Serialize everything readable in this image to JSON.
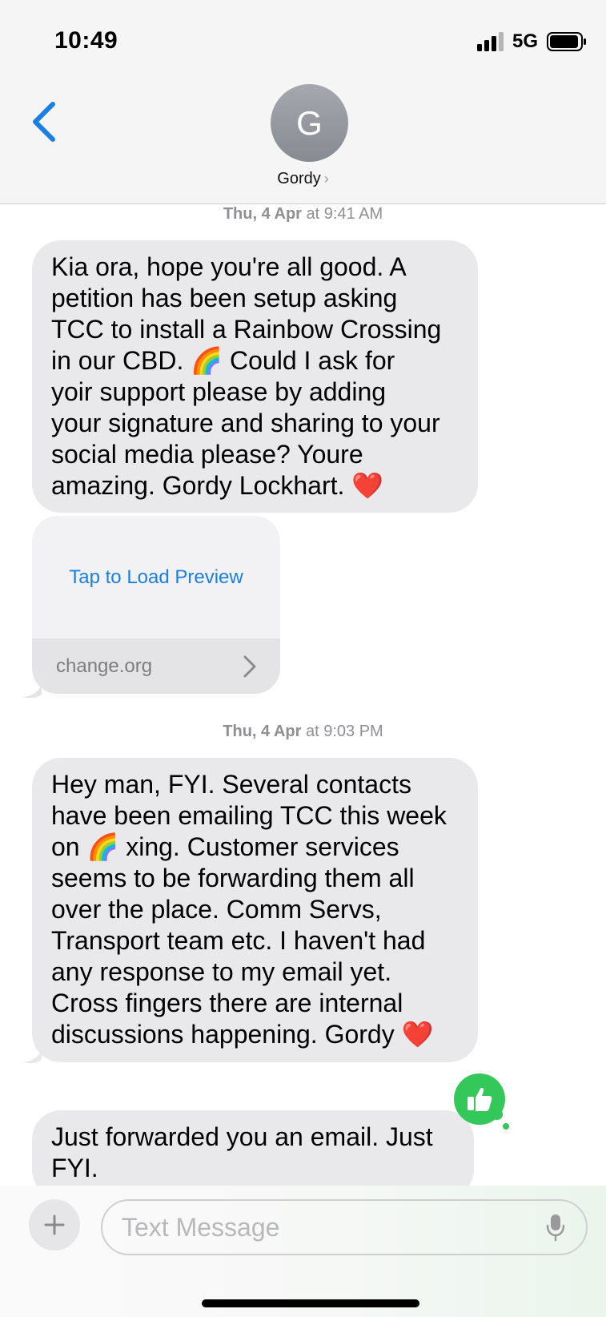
{
  "status_bar": {
    "time": "10:49",
    "network": "5G"
  },
  "header": {
    "avatar_initial": "G",
    "contact_name": "Gordy",
    "chevron": "›"
  },
  "conversation": {
    "timestamp_1": {
      "date": "Thu, 4 Apr",
      "connector": "at",
      "time": "9:41 AM"
    },
    "message_1": {
      "lines": [
        "Kia ora, hope you're all good. A",
        "petition has been setup asking",
        "TCC to install a Rainbow Crossing",
        "in our CBD. 🌈  Could I ask for",
        "yoir support please by adding",
        "your signature and sharing to your",
        "social media please? Youre",
        "amazing. Gordy Lockhart. ❤️"
      ]
    },
    "link_preview": {
      "action": "Tap to Load Preview",
      "domain": "change.org",
      "chevron": "›"
    },
    "timestamp_2": {
      "date": "Thu, 4 Apr",
      "connector": "at",
      "time": "9:03 PM"
    },
    "message_2": {
      "lines": [
        "Hey man, FYI. Several contacts",
        "have been emailing TCC this week",
        "on 🌈 xing. Customer services",
        "seems to be forwarding them all",
        "over the place. Comm Servs,",
        "Transport team etc. I haven't had",
        "any response to my email yet.",
        "Cross fingers there are internal",
        "discussions happening. Gordy ❤️"
      ]
    },
    "message_3": {
      "lines": [
        "Just forwarded you an email. Just",
        "FYI."
      ]
    },
    "reaction": {
      "icon": "thumbs-up-icon",
      "color": "#34c759"
    }
  },
  "composer": {
    "placeholder": "Text Message",
    "value": ""
  },
  "colors": {
    "link_blue": "#1a7fe0",
    "bubble_gray": "#e9e9eb",
    "reaction_green": "#34c759",
    "ios_blue": "#1a7fe0"
  }
}
